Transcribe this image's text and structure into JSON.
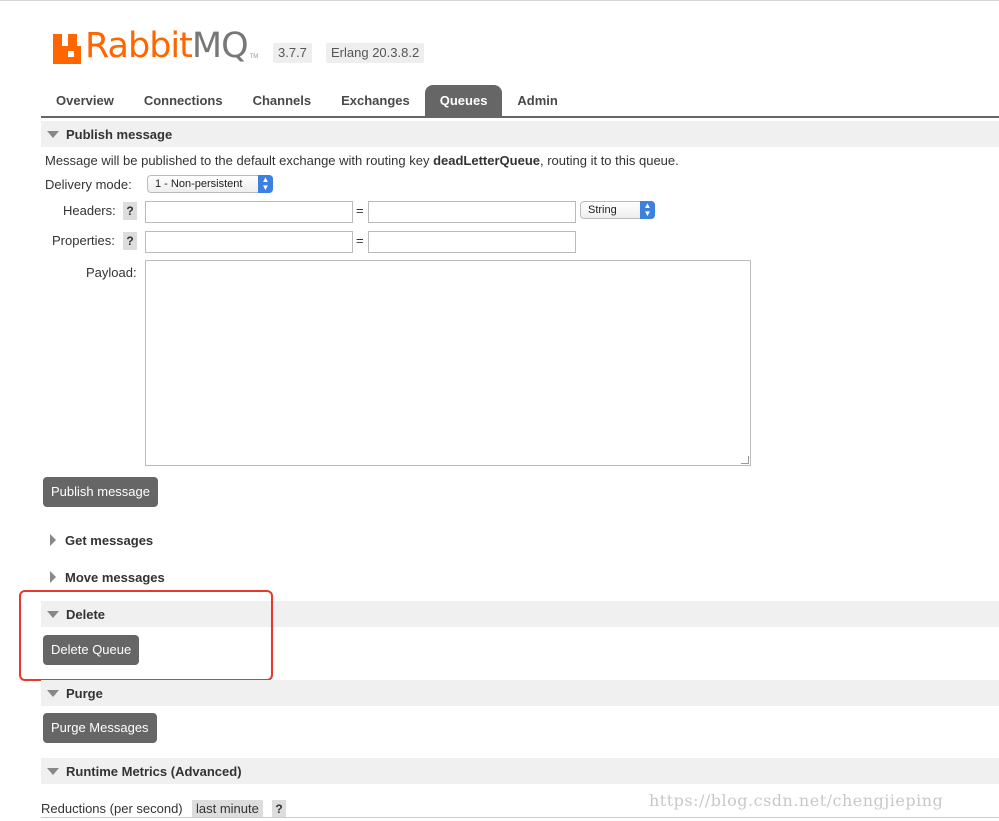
{
  "header": {
    "logo_main": "Rabbit",
    "logo_accent": "MQ",
    "logo_tm": "TM",
    "version": "3.7.7",
    "erlang": "Erlang 20.3.8.2"
  },
  "tabs": [
    {
      "label": "Overview",
      "active": false
    },
    {
      "label": "Connections",
      "active": false
    },
    {
      "label": "Channels",
      "active": false
    },
    {
      "label": "Exchanges",
      "active": false
    },
    {
      "label": "Queues",
      "active": true
    },
    {
      "label": "Admin",
      "active": false
    }
  ],
  "publish": {
    "title": "Publish message",
    "info_prefix": "Message will be published to the default exchange with routing key ",
    "routing_key": "deadLetterQueue",
    "info_suffix": ", routing it to this queue.",
    "delivery_mode_label": "Delivery mode:",
    "delivery_mode_value": "1 - Non-persistent",
    "headers_label": "Headers:",
    "headers_type": "String",
    "properties_label": "Properties:",
    "help": "?",
    "equals": "=",
    "payload_label": "Payload:",
    "button": "Publish message"
  },
  "get_messages": {
    "title": "Get messages"
  },
  "move_messages": {
    "title": "Move messages"
  },
  "delete": {
    "title": "Delete",
    "button": "Delete Queue"
  },
  "purge": {
    "title": "Purge",
    "button": "Purge Messages"
  },
  "runtime": {
    "title": "Runtime Metrics (Advanced)",
    "reductions_label": "Reductions (per second)",
    "range": "last minute",
    "help": "?"
  },
  "watermark": "https://blog.csdn.net/chengjieping",
  "colors": {
    "brand": "#ff6600",
    "tab_active": "#666666",
    "highlight_box": "#e8372c",
    "select_arrow": "#3b82e0"
  }
}
